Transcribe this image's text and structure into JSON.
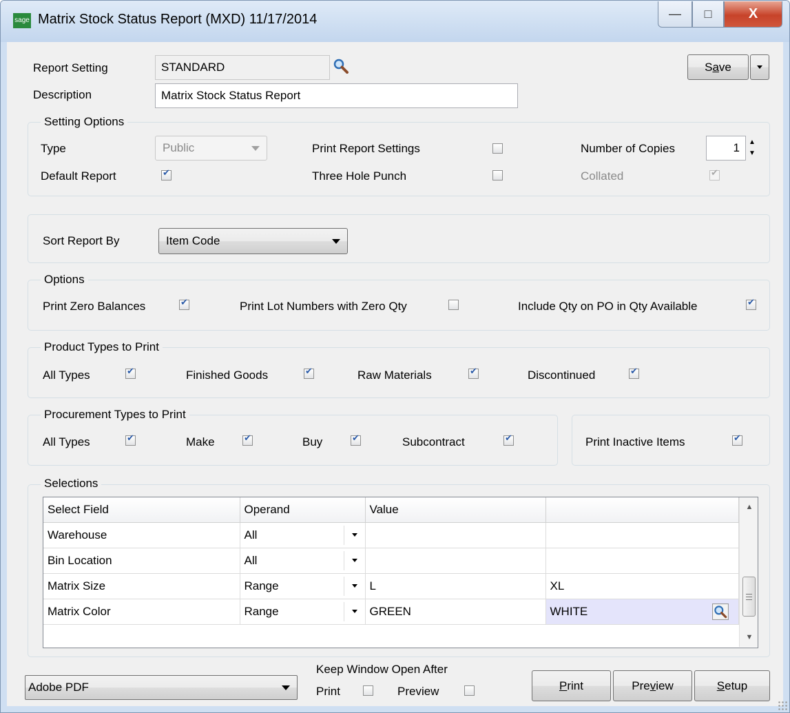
{
  "window": {
    "app_logo": "sage",
    "title": "Matrix Stock Status Report (MXD) 11/17/2014",
    "min_glyph": "—",
    "max_glyph": "□",
    "close_glyph": "X"
  },
  "header": {
    "report_setting_label": "Report Setting",
    "report_setting_value": "STANDARD",
    "description_label": "Description",
    "description_value": "Matrix Stock Status Report",
    "save_label_pre": "S",
    "save_label_u": "a",
    "save_label_post": "ve"
  },
  "setting_options": {
    "title": "Setting Options",
    "type_label": "Type",
    "type_value": "Public",
    "print_report_settings_label": "Print Report Settings",
    "print_report_settings_checked": false,
    "number_of_copies_label": "Number of Copies",
    "number_of_copies_value": "1",
    "default_report_label": "Default Report",
    "default_report_checked": true,
    "three_hole_punch_label": "Three Hole Punch",
    "three_hole_punch_checked": false,
    "collated_label": "Collated",
    "collated_checked": true
  },
  "sort": {
    "label": "Sort Report By",
    "value": "Item Code"
  },
  "options": {
    "title": "Options",
    "print_zero_balances_label": "Print Zero Balances",
    "print_zero_balances_checked": true,
    "print_lot_numbers_label": "Print Lot Numbers with Zero Qty",
    "print_lot_numbers_checked": false,
    "include_qty_po_label": "Include Qty on PO in Qty Available",
    "include_qty_po_checked": true
  },
  "product_types": {
    "title": "Product Types to Print",
    "all_types_label": "All Types",
    "finished_goods_label": "Finished Goods",
    "raw_materials_label": "Raw Materials",
    "discontinued_label": "Discontinued"
  },
  "procurement_types": {
    "title": "Procurement Types to Print",
    "all_types_label": "All Types",
    "make_label": "Make",
    "buy_label": "Buy",
    "subcontract_label": "Subcontract"
  },
  "inactive": {
    "label": "Print Inactive Items",
    "checked": true
  },
  "selections": {
    "title": "Selections",
    "columns": [
      "Select Field",
      "Operand",
      "Value",
      ""
    ],
    "rows": [
      {
        "field": "Warehouse",
        "operand": "All",
        "value": "",
        "value2": ""
      },
      {
        "field": "Bin Location",
        "operand": "All",
        "value": "",
        "value2": ""
      },
      {
        "field": "Matrix Size",
        "operand": "Range",
        "value": "L",
        "value2": "XL"
      },
      {
        "field": "Matrix Color",
        "operand": "Range",
        "value": "GREEN",
        "value2": "WHITE"
      }
    ]
  },
  "footer": {
    "printer_value": "Adobe PDF",
    "keep_open_label": "Keep Window Open After",
    "print_label": "Print",
    "print_checked": false,
    "preview_label": "Preview",
    "preview_checked": false,
    "print_button_u": "P",
    "print_button_rest": "rint",
    "preview_button_pre": "Pre",
    "preview_button_u": "v",
    "preview_button_post": "iew",
    "setup_button_u": "S",
    "setup_button_rest": "etup"
  },
  "colors": {
    "titlebar": "#cfdff2",
    "close_button": "#c7432a",
    "check_mark": "#2a5aa8",
    "highlight_cell": "#e4e4fb"
  }
}
